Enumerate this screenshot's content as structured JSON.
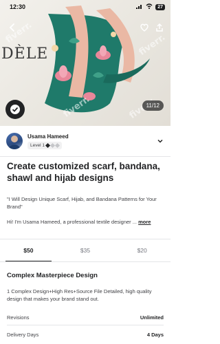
{
  "status_bar": {
    "time": "12:30",
    "battery": "27"
  },
  "hero": {
    "brand_text": "DÈLE",
    "watermark": "fiverr.",
    "image_counter": "11/12"
  },
  "seller": {
    "name": "Usama Hameed",
    "level": "Level 1"
  },
  "gig": {
    "title": "Create customized scarf, bandana, shawl and hijab designs",
    "quote": "\"I Will Design Unique Scarf, Hijab, and Bandana Patterns for Your Brand\"",
    "intro": "Hi! I'm Usama Hameed, a professional textile designer ...",
    "more_label": "more"
  },
  "tabs": [
    {
      "label": "$50",
      "active": true
    },
    {
      "label": "$35",
      "active": false
    },
    {
      "label": "$20",
      "active": false
    }
  ],
  "package": {
    "title": "Complex Masterpiece Design",
    "description": "1 Complex Design+High Res+Source File Detailed, high quality design that makes your brand stand out.",
    "details": [
      {
        "label": "Revisions",
        "value": "Unlimited"
      },
      {
        "label": "Delivery Days",
        "value": "4 Days"
      }
    ]
  },
  "colors": {
    "accent": "#222325",
    "scarf_teal": "#1f7a6a",
    "scarf_peach": "#eab8a4",
    "scarf_pink": "#e8879a"
  }
}
